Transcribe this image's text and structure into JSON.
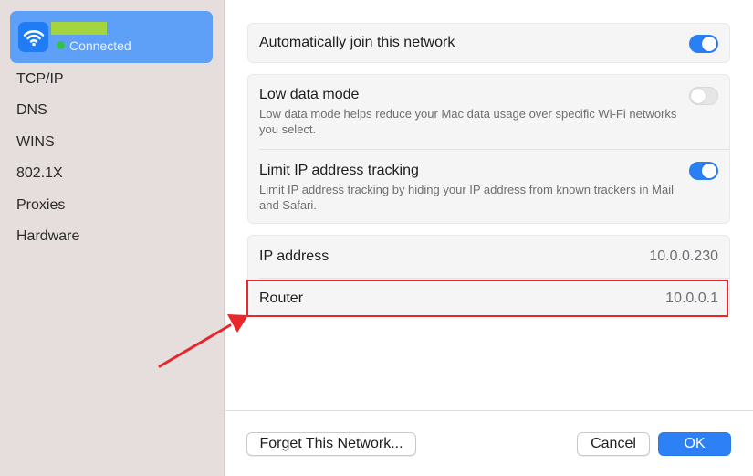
{
  "sidebar": {
    "network": {
      "status": "Connected",
      "icon": "wifi-icon",
      "name_redaction_color": "#a4d53f",
      "status_color": "#31c24c"
    },
    "items": [
      {
        "label": "TCP/IP"
      },
      {
        "label": "DNS"
      },
      {
        "label": "WINS"
      },
      {
        "label": "802.1X"
      },
      {
        "label": "Proxies"
      },
      {
        "label": "Hardware"
      }
    ]
  },
  "settings": {
    "auto_join": {
      "label": "Automatically join this network",
      "enabled": true
    },
    "low_data": {
      "label": "Low data mode",
      "description": "Low data mode helps reduce your Mac data usage over specific Wi-Fi networks you select.",
      "enabled": false
    },
    "limit_ip": {
      "label": "Limit IP address tracking",
      "description": "Limit IP address tracking by hiding your IP address from known trackers in Mail and Safari.",
      "enabled": true
    },
    "info": {
      "ip_label": "IP address",
      "ip_value": "10.0.0.230",
      "router_label": "Router",
      "router_value": "10.0.0.1"
    }
  },
  "footer": {
    "forget_label": "Forget This Network...",
    "cancel_label": "Cancel",
    "ok_label": "OK"
  },
  "colors": {
    "accent": "#2e80f7",
    "highlight": "#e8262c",
    "sidebar_bg": "#e6dedd"
  }
}
